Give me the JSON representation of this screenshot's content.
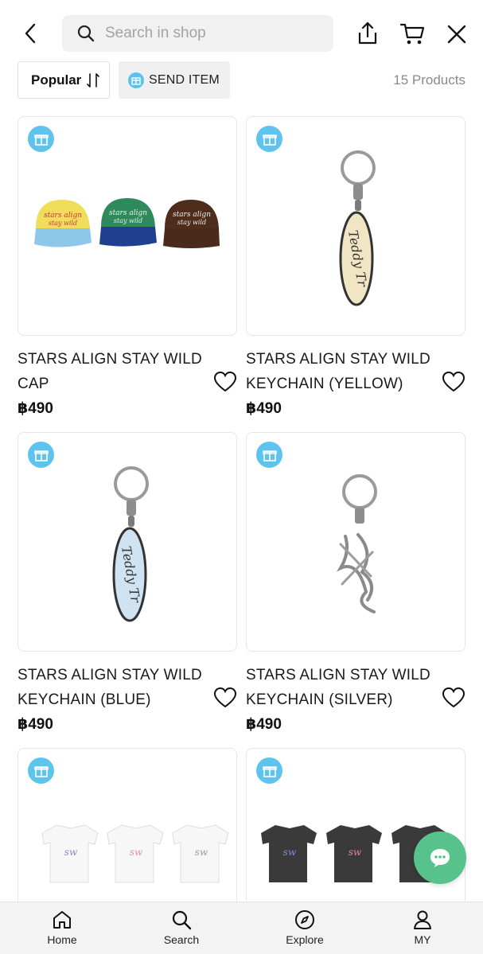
{
  "header": {
    "search_placeholder": "Search in shop",
    "icons": [
      "back-icon",
      "search-icon",
      "share-icon",
      "cart-icon",
      "close-icon"
    ]
  },
  "filters": {
    "sort_label": "Popular",
    "send_label": "SEND ITEM",
    "count_text": "15 Products"
  },
  "products": [
    {
      "name": "STARS ALIGN STAY WILD CAP",
      "price": "฿490",
      "image": "caps"
    },
    {
      "name": "STARS ALIGN STAY WILD KEYCHAIN (YELLOW)",
      "price": "฿490",
      "image": "keychain-yellow"
    },
    {
      "name": "STARS ALIGN STAY WILD KEYCHAIN (BLUE)",
      "price": "฿490",
      "image": "keychain-blue"
    },
    {
      "name": "STARS ALIGN STAY WILD KEYCHAIN (SILVER)",
      "price": "฿490",
      "image": "keychain-silver"
    },
    {
      "name": "",
      "price": "",
      "image": "white-tshirts"
    },
    {
      "name": "",
      "price": "",
      "image": "black-tshirts"
    }
  ],
  "bottom_nav": [
    {
      "label": "Home",
      "icon": "home-icon"
    },
    {
      "label": "Search",
      "icon": "search-icon"
    },
    {
      "label": "Explore",
      "icon": "compass-icon"
    },
    {
      "label": "MY",
      "icon": "user-icon"
    }
  ],
  "colors": {
    "accent_gift": "#5ec4ee",
    "chat_green": "#58c28c"
  }
}
